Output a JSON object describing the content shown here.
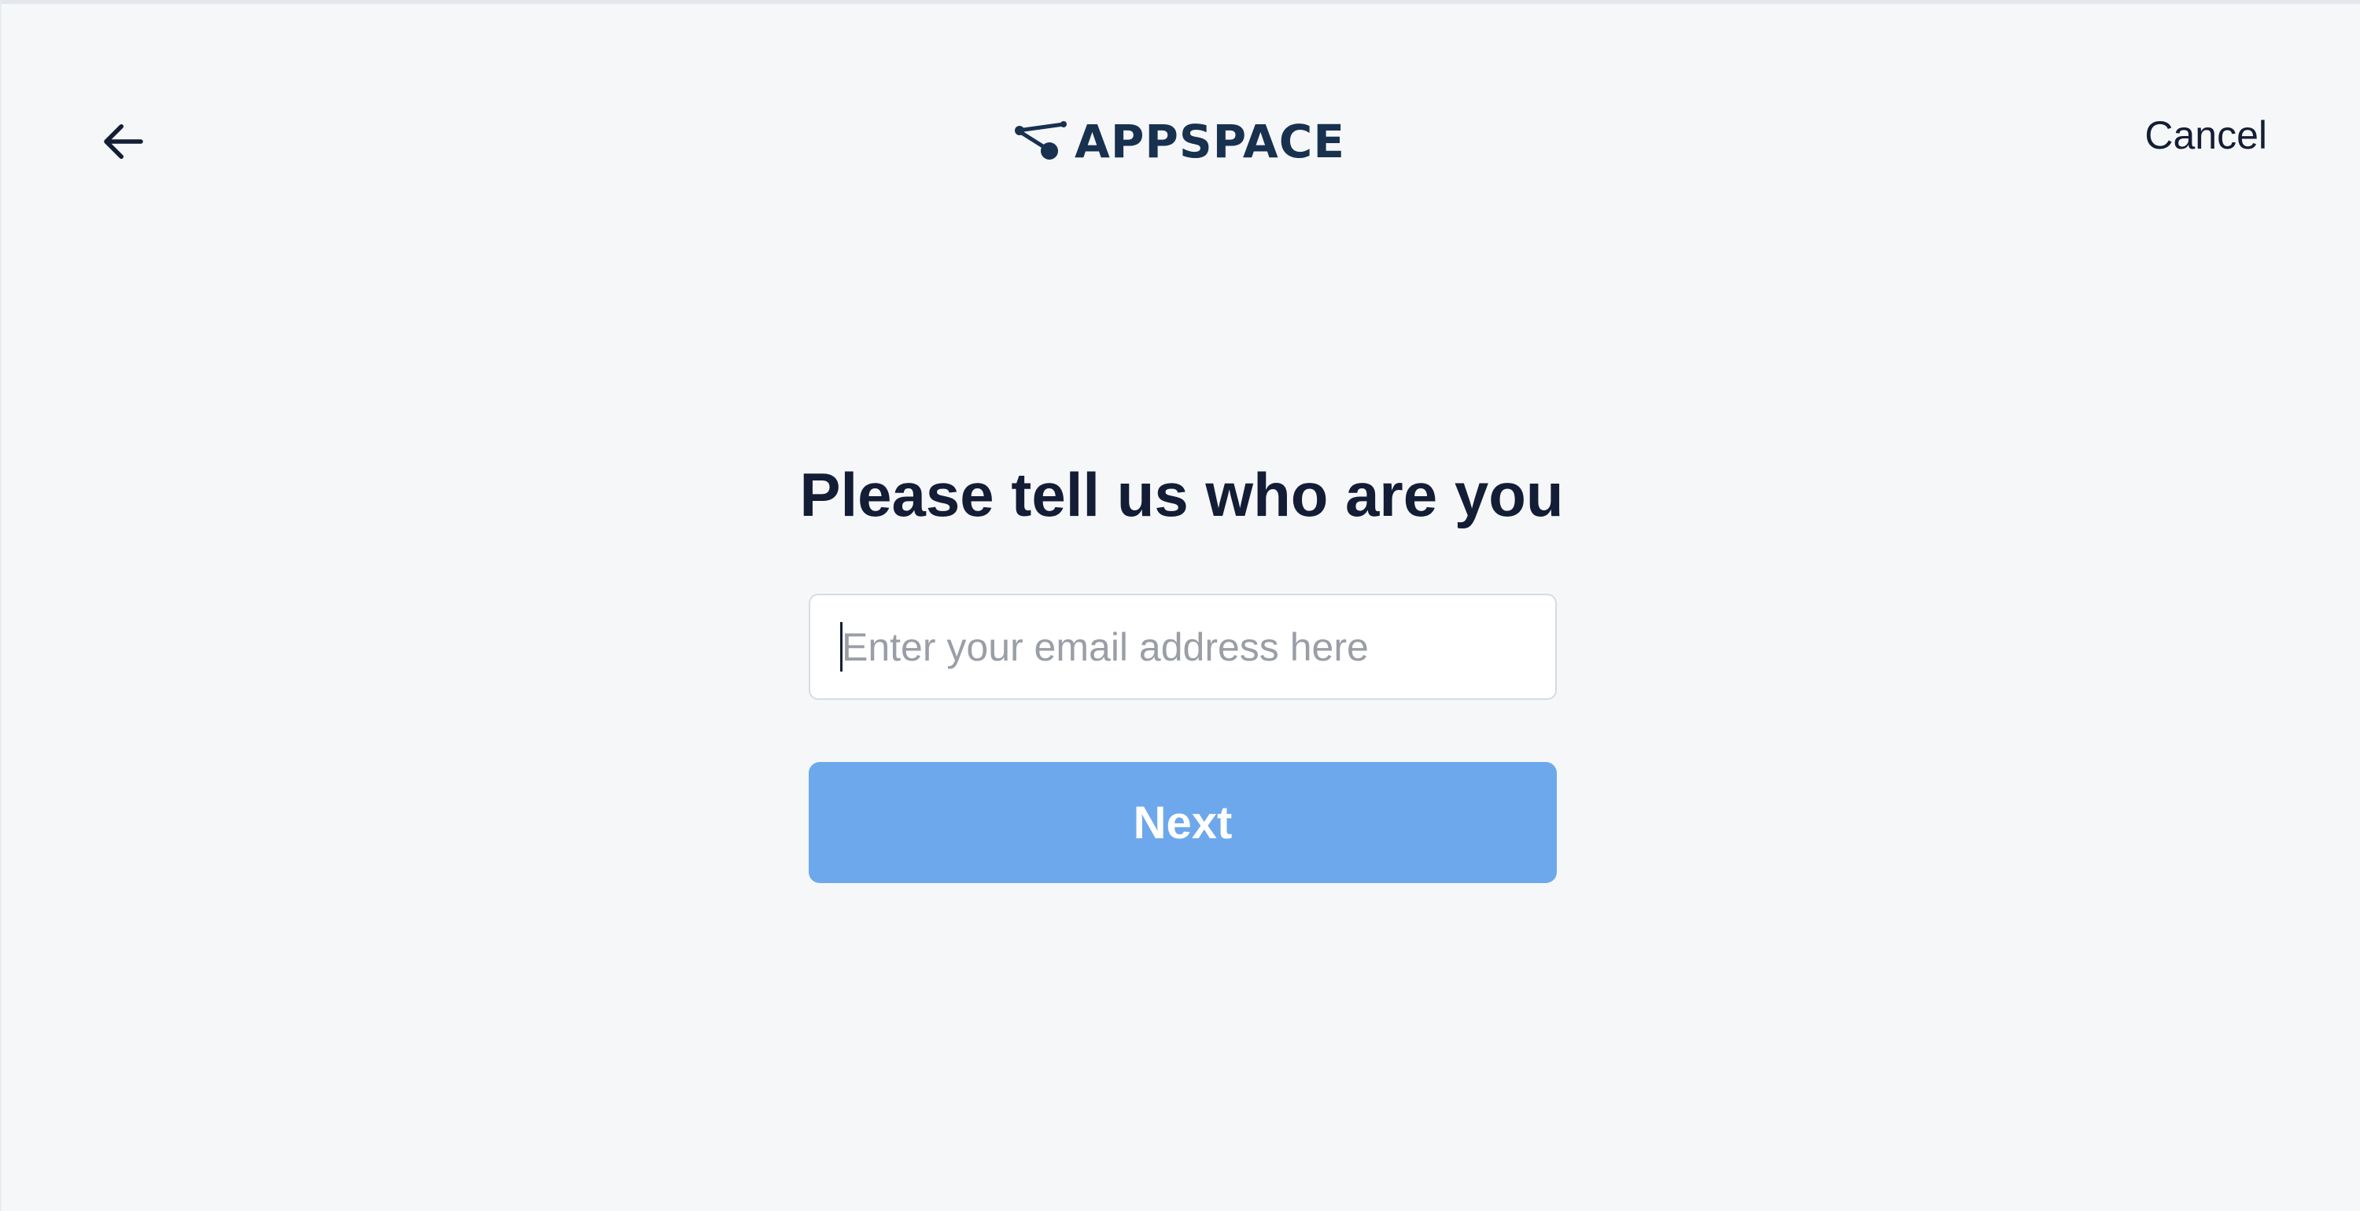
{
  "header": {
    "back_icon": "arrow-left-icon",
    "logo_text": "APPSPACE",
    "cancel_label": "Cancel"
  },
  "main": {
    "title": "Please tell us who are you",
    "email_field": {
      "value": "",
      "placeholder": "Enter your email address here"
    },
    "next_label": "Next"
  },
  "colors": {
    "background": "#f6f7f9",
    "text_primary": "#131d35",
    "brand": "#18314f",
    "next_button": "#6ea8ec",
    "placeholder": "#9a9ea6"
  }
}
